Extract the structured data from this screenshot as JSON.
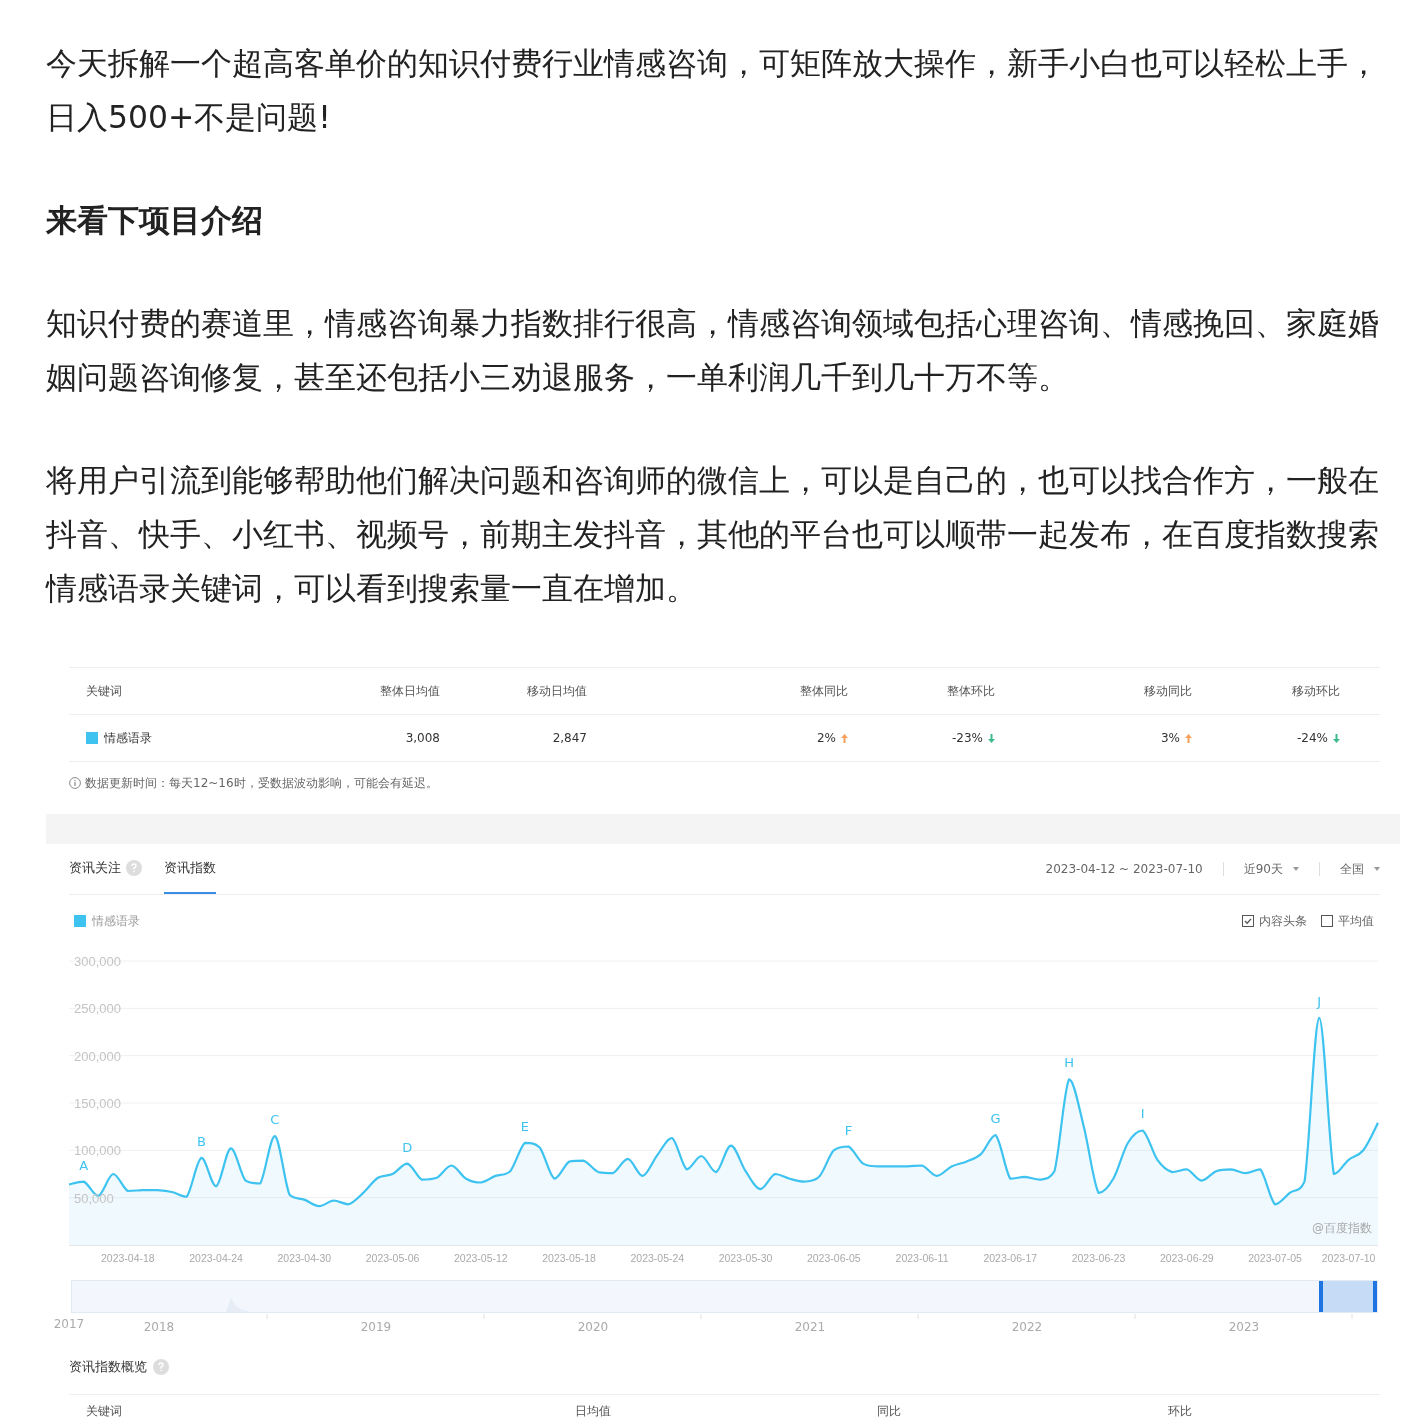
{
  "article": {
    "blocks": [
      {
        "kind": "text",
        "text": "今天拆解一个超高客单价的知识付费行业情感咨询，可矩阵放大操作，新手小白也可以轻松上手，日入500+不是问题!"
      },
      {
        "kind": "heading",
        "text": "来看下项目介绍"
      },
      {
        "kind": "text",
        "text": "知识付费的赛道里，情感咨询暴力指数排行很高，情感咨询领域包括心理咨询、情感挽回、家庭婚姻问题咨询修复，甚至还包括小三劝退服务，一单利润几千到几十万不等。"
      },
      {
        "kind": "text",
        "text": "将用户引流到能够帮助他们解决问题和咨询师的微信上，可以是自己的，也可以找合作方，一般在抖音、快手、小红书、视频号，前期主发抖音，其他的平台也可以顺带一起发布，在百度指数搜索情感语录关键词，可以看到搜索量一直在增加。"
      }
    ]
  },
  "index_widget": {
    "summary_table": {
      "columns": [
        "关键词",
        "整体日均值",
        "移动日均值",
        "整体同比",
        "整体环比",
        "移动同比",
        "移动环比"
      ],
      "rows": [
        {
          "cells": [
            {
              "text": "情感语录",
              "color": "#3ec3f0"
            },
            {
              "text": "3,008"
            },
            {
              "text": "2,847"
            },
            {
              "text": "2%",
              "increase": true
            },
            {
              "text": "-23%",
              "increase": false
            },
            {
              "text": "3%",
              "increase": true
            },
            {
              "text": "-24%",
              "increase": false
            }
          ]
        }
      ]
    },
    "note": "数据更新时间：每天12~16时，受数据波动影响，可能会有延迟。",
    "tabs": [
      {
        "label": "资讯关注",
        "help": true,
        "selected": false
      },
      {
        "label": "资讯指数",
        "help": false,
        "selected": true
      }
    ],
    "date_range": "2023-04-12 ~ 2023-07-10",
    "dropdowns": [
      {
        "value": "近90天"
      },
      {
        "value": "全国"
      }
    ],
    "toggles": [
      {
        "label": "内容头条",
        "checked": true
      },
      {
        "label": "平均值",
        "checked": false
      }
    ],
    "chart_data": {
      "type": "area",
      "grid": true,
      "categories": [
        null,
        null,
        null,
        null,
        "2023-04-18",
        null,
        null,
        null,
        null,
        null,
        "2023-04-24",
        null,
        null,
        null,
        null,
        null,
        "2023-04-30",
        null,
        null,
        null,
        null,
        null,
        "2023-05-06",
        null,
        null,
        null,
        null,
        null,
        "2023-05-12",
        null,
        null,
        null,
        null,
        null,
        "2023-05-18",
        null,
        null,
        null,
        null,
        null,
        "2023-05-24",
        null,
        null,
        null,
        null,
        null,
        "2023-05-30",
        null,
        null,
        null,
        null,
        null,
        "2023-06-05",
        null,
        null,
        null,
        null,
        null,
        "2023-06-11",
        null,
        null,
        null,
        null,
        null,
        "2023-06-17",
        null,
        null,
        null,
        null,
        null,
        "2023-06-23",
        null,
        null,
        null,
        null,
        null,
        "2023-06-29",
        null,
        null,
        null,
        null,
        null,
        "2023-07-05",
        null,
        null,
        null,
        null,
        "2023-07-10",
        null,
        null
      ],
      "series": [
        {
          "name": "情感语录",
          "color": "#3ec3f0",
          "values": [
            64000,
            67000,
            52000,
            75000,
            57000,
            58000,
            58000,
            56000,
            51000,
            92000,
            62000,
            102000,
            68000,
            65000,
            115000,
            53000,
            48000,
            41000,
            47000,
            43000,
            55000,
            71000,
            75000,
            86000,
            69000,
            71000,
            84000,
            70000,
            66000,
            73000,
            78000,
            108000,
            103000,
            70000,
            88000,
            89000,
            77000,
            76000,
            91000,
            73000,
            95000,
            113000,
            80000,
            94000,
            77000,
            105000,
            78000,
            59000,
            75000,
            70000,
            67000,
            72000,
            100000,
            104000,
            86000,
            83000,
            83000,
            83000,
            84000,
            73000,
            83000,
            88000,
            96000,
            116000,
            70000,
            72000,
            69000,
            78000,
            175000,
            125000,
            55000,
            70000,
            108000,
            121000,
            90000,
            77000,
            80000,
            68000,
            78000,
            80000,
            76000,
            80000,
            43000,
            55000,
            67000,
            240000,
            75000,
            90000,
            100000,
            129000
          ]
        }
      ],
      "ylim": [
        0,
        300000
      ],
      "yticks": [
        {
          "value": 50000,
          "label": "50,000"
        },
        {
          "value": 100000,
          "label": "100,000"
        },
        {
          "value": 150000,
          "label": "150,000"
        },
        {
          "value": 200000,
          "label": "200,000"
        },
        {
          "value": 250000,
          "label": "250,000"
        },
        {
          "value": 300000,
          "label": "300,000"
        }
      ],
      "value_labels": [
        null,
        "A",
        null,
        null,
        null,
        null,
        null,
        null,
        null,
        "B",
        null,
        null,
        null,
        null,
        "C",
        null,
        null,
        null,
        null,
        null,
        null,
        null,
        null,
        "D",
        null,
        null,
        null,
        null,
        null,
        null,
        null,
        "E",
        null,
        null,
        null,
        null,
        null,
        null,
        null,
        null,
        null,
        null,
        null,
        null,
        null,
        null,
        null,
        null,
        null,
        null,
        null,
        null,
        null,
        "F",
        null,
        null,
        null,
        null,
        null,
        null,
        null,
        null,
        null,
        "G",
        null,
        null,
        null,
        null,
        "H",
        null,
        null,
        null,
        null,
        "I",
        null,
        null,
        null,
        null,
        null,
        null,
        null,
        null,
        null,
        null,
        null,
        "J",
        null,
        null,
        null,
        null
      ]
    },
    "chart_credit": "@百度指数",
    "timeline": {
      "years": [
        "2017",
        "2018",
        "2019",
        "2020",
        "2021",
        "2022",
        "2023"
      ]
    },
    "overview": {
      "title": "资讯指数概览",
      "help": true,
      "columns": [
        "关键词",
        "日均值",
        "同比",
        "环比"
      ]
    }
  }
}
